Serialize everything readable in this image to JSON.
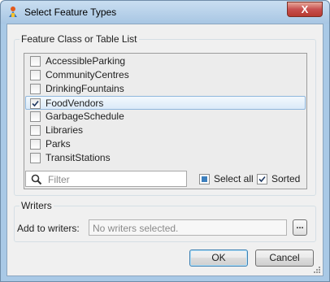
{
  "window": {
    "title": "Select Feature Types",
    "close_glyph": "X",
    "icon": "fme-feature-icon"
  },
  "feature_group": {
    "legend": "Feature Class or Table List",
    "items": [
      {
        "label": "AccessibleParking",
        "checked": false,
        "selected": false
      },
      {
        "label": "CommunityCentres",
        "checked": false,
        "selected": false
      },
      {
        "label": "DrinkingFountains",
        "checked": false,
        "selected": false
      },
      {
        "label": "FoodVendors",
        "checked": true,
        "selected": true
      },
      {
        "label": "GarbageSchedule",
        "checked": false,
        "selected": false
      },
      {
        "label": "Libraries",
        "checked": false,
        "selected": false
      },
      {
        "label": "Parks",
        "checked": false,
        "selected": false
      },
      {
        "label": "TransitStations",
        "checked": false,
        "selected": false
      }
    ],
    "filter_placeholder": "Filter",
    "select_all_label": "Select all",
    "select_all_state": "indeterminate",
    "sorted_label": "Sorted",
    "sorted_checked": true
  },
  "writers_group": {
    "legend": "Writers",
    "add_label": "Add to writers:",
    "add_placeholder": "No writers selected.",
    "browse_label": "..."
  },
  "buttons": {
    "ok": "OK",
    "cancel": "Cancel"
  },
  "colors": {
    "title_bar": "#a8c6e3",
    "close_button": "#c75050",
    "selection": "#dbeaf8",
    "default_button_border": "#3c7fb1"
  }
}
